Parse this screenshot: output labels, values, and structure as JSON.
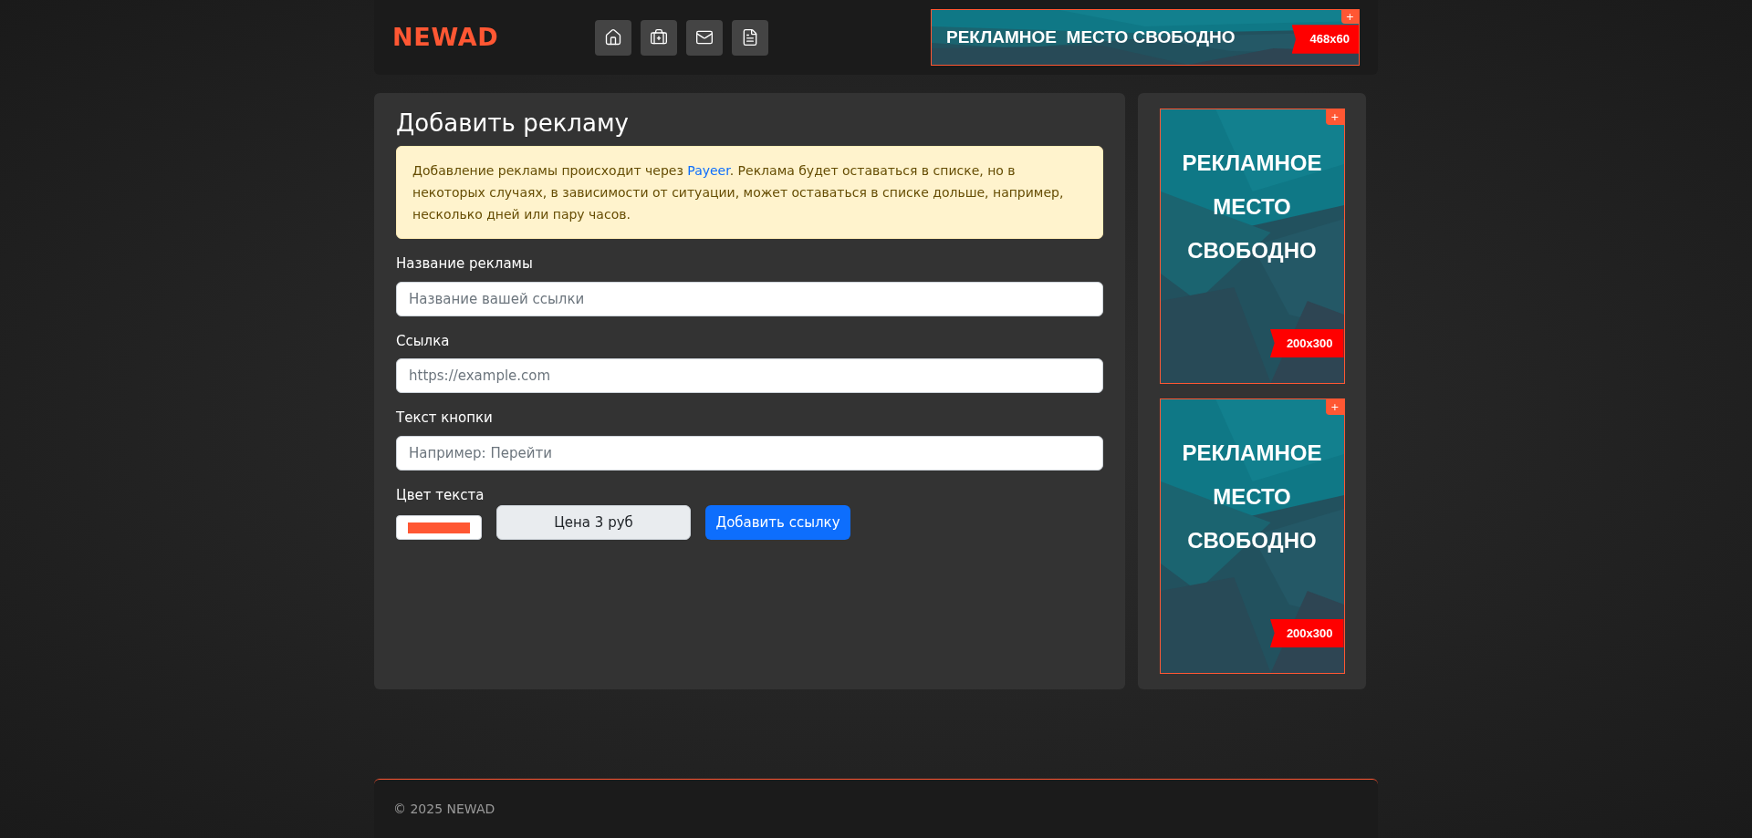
{
  "header": {
    "logo": "NEWAD",
    "nav": [
      {
        "kind": "home"
      },
      {
        "kind": "add"
      },
      {
        "kind": "mail"
      },
      {
        "kind": "document"
      }
    ],
    "banner": {
      "text": "РЕКЛАМНОЕ  МЕСТО СВОБОДНО",
      "size": "468x60",
      "plus": "+"
    }
  },
  "form": {
    "title": "Добавить рекламу",
    "notice": {
      "before": "Добавление рекламы происходит через ",
      "link": "Payeer",
      "after": ". Реклама будет оставаться в списке, но в некоторых случаях, в зависимости от ситуации, может оставаться в списке дольше, например, несколько дней или пару часов."
    },
    "fields": [
      {
        "label": "Название рекламы",
        "placeholder": "Название вашей ссылки"
      },
      {
        "label": "Ссылка",
        "placeholder": "https://example.com"
      },
      {
        "label": "Текст кнопки",
        "placeholder": "Например: Перейти"
      }
    ],
    "text_color": {
      "label": "Цвет текста",
      "color": "#ff5733"
    },
    "price": "Цена 3 руб",
    "submit": "Добавить ссылку"
  },
  "sidebar": {
    "ads": [
      {
        "lines": [
          "РЕКЛАМНОЕ",
          "МЕСТО",
          "СВОБОДНО"
        ],
        "size": "200x300",
        "plus": "+"
      },
      {
        "lines": [
          "РЕКЛАМНОЕ",
          "МЕСТО",
          "СВОБОДНО"
        ],
        "size": "200x300",
        "plus": "+"
      }
    ]
  },
  "footer": {
    "copyright": "© 2025 NEWAD"
  }
}
